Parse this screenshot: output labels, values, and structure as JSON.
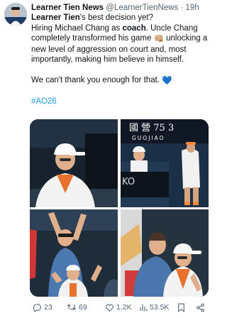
{
  "tweet": {
    "author_name": "Learner Tien News",
    "handle": "@LearnerTienNews",
    "separator": "·",
    "time": "19h",
    "body": {
      "line1_name": "Learner Tien",
      "line1_rest": "'s best decision yet?",
      "line2_pre": "Hiring Michael Chang as ",
      "line2_bold": "coach",
      "line2_post": ". Uncle Chang completely transformed his game ",
      "line2_emoji": "👊🏼",
      "line2_tail": " unlocking a new level of aggression on court and, most importantly, making him believe in himself.",
      "line3": "We can't thank you enough for that. ",
      "line3_emoji": "💙",
      "hashtag": "#AO26"
    },
    "media": {
      "photo2_sign_text": "國 營 75 3",
      "photo2_sign_subtext": "GUOJIAO",
      "photo2_board_text": "KO"
    },
    "actions": {
      "replies": "23",
      "reposts": "69",
      "likes": "1.2K",
      "views": "53.5K"
    }
  },
  "colors": {
    "accent": "#1d9bf0",
    "text": "#0f1419",
    "muted": "#536471",
    "heart": "#0081ff"
  }
}
